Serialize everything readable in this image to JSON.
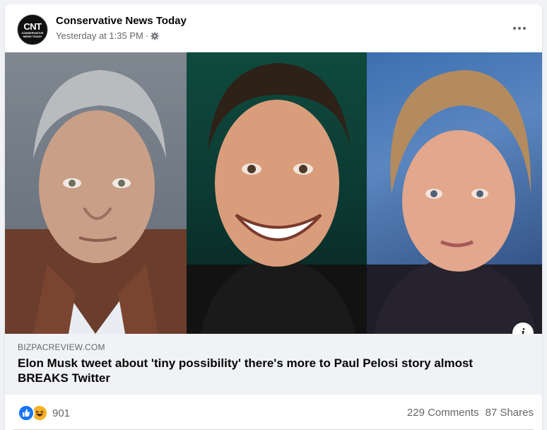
{
  "post": {
    "page_name": "Conservative News Today",
    "avatar_text": "CNT",
    "avatar_subtext": "CONSERVATIVE NEWS TODAY",
    "timestamp": "Yesterday at 1:35 PM",
    "audience_icon": "gear-icon"
  },
  "link": {
    "domain": "BIZPACREVIEW.COM",
    "headline": "Elon Musk tweet about 'tiny possibility' there's more to Paul Pelosi story almost BREAKS Twitter"
  },
  "footer": {
    "reaction_icons": [
      "like-icon",
      "haha-icon"
    ],
    "reaction_count": "901",
    "comments": "229 Comments",
    "shares": "87 Shares"
  },
  "colors": {
    "like": "#1877f2",
    "haha": "#f7b125",
    "secondary_text": "#65676b",
    "link_bg": "#f0f2f5"
  }
}
